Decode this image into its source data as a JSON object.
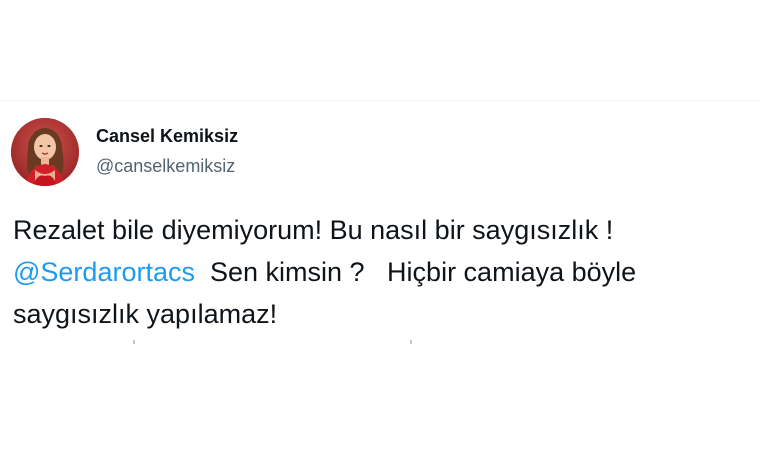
{
  "tweet": {
    "author": {
      "display_name": "Cansel Kemiksiz",
      "handle": "@canselkemiksiz"
    },
    "text": {
      "line1": "Rezalet bile diyemiyorum! Bu nasıl bir saygısızlık !",
      "mention": "@Serdarortacs",
      "line2_rest": "  Sen kimsin ?   Hiçbir camiaya böyle",
      "line3": "saygısızlık yapılamaz!"
    }
  },
  "colors": {
    "mention": "#1d9bf0",
    "text": "#0f1419",
    "handle": "#536471",
    "avatar_bg": "#b8322f"
  },
  "icons": {
    "avatar": "profile-photo"
  }
}
